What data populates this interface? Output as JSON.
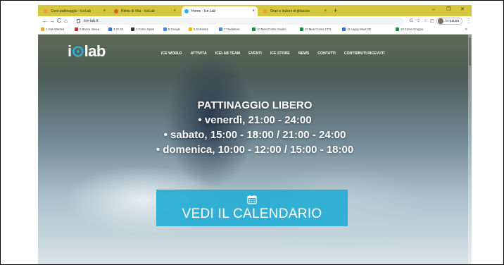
{
  "browser": {
    "tabs": [
      {
        "label": "Corsi pattinaggio - IceLab",
        "active": false,
        "favicon_color": "#e8a23a"
      },
      {
        "label": "Ritmo di Vita - IceLab",
        "active": false,
        "favicon_color": "#e05a2a"
      },
      {
        "label": "Home - Ice Lab",
        "active": true,
        "favicon_color": "#2bb3e0"
      },
      {
        "label": "Orari e lezioni di ghiaccio",
        "active": false,
        "favicon_color": "#e8a23a"
      }
    ],
    "new_tab_glyph": "+",
    "window_controls": {
      "minimize": "–",
      "restore": "❐",
      "close": "✕"
    },
    "nav": {
      "back": "←",
      "forward": "→",
      "reload": "C",
      "home": "⌂"
    },
    "url": "ice-lab.it",
    "address_icons": [
      "google-lens-icon",
      "share-icon",
      "star-icon",
      "sidepanel-icon"
    ],
    "address_glyphs": {
      "lens": "G",
      "share": "⇪",
      "star": "☆",
      "panel": "◫"
    },
    "profile_label": "In pausa",
    "bookmarks": [
      {
        "label": "1 Dati Wanted",
        "color": "#e8a23a"
      },
      {
        "label": "2 Banca Intesa",
        "color": "#c0392b"
      },
      {
        "label": "3 IO Sit",
        "color": "#3a6fd8"
      },
      {
        "label": "4 Corso Sport",
        "color": "#333333"
      },
      {
        "label": "5 Google",
        "color": "#4285f4"
      },
      {
        "label": "6 5 Monitor",
        "color": "#f4b400"
      },
      {
        "label": "7 Traduttore",
        "color": "#4285f4"
      },
      {
        "label": "10 Meet Corso Giudici",
        "color": "#1e8e3e"
      },
      {
        "label": "10 Meet Corso CTG",
        "color": "#1e8e3e"
      },
      {
        "label": "11 Lappy Meet 3D",
        "color": "#3a6fd8"
      },
      {
        "label": "19 Corso Gruppo",
        "color": "#1e8e3e"
      }
    ],
    "bookmarks_more": "»"
  },
  "site": {
    "logo": {
      "pre": "i",
      "ring": "⊙",
      "post": "lab"
    },
    "nav": [
      "ICE WORLD",
      "ATTIVITÀ",
      "ICELAB TEAM",
      "EVENTI",
      "ICE STORE",
      "NEWS",
      "CONTATTI",
      "CONTRIBUTI RICEVUTI"
    ],
    "hero": {
      "title": "PATTINAGGIO LIBERO",
      "lines": [
        "• venerdì, 21:00 - 24:00",
        "• sabato, 15:00 - 18:00 / 21:00 - 24:00",
        "• domenica, 10:00 - 12:00 / 15:00 - 18:00"
      ]
    },
    "cta_label": "VEDI IL CALENDARIO"
  },
  "colors": {
    "tabstrip": "#d6c63b",
    "accent": "#2bb3e0",
    "cta": "#26acd4"
  }
}
